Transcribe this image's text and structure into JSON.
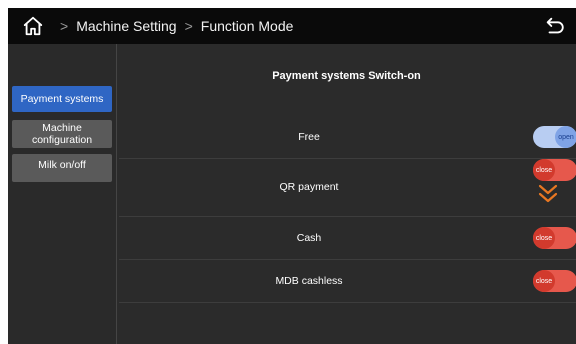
{
  "header": {
    "breadcrumbs": [
      "Machine Setting",
      "Function Mode"
    ]
  },
  "sidebar": {
    "items": [
      {
        "label": "Payment systems"
      },
      {
        "label": "Machine configuration"
      },
      {
        "label": "Milk on/off"
      }
    ]
  },
  "main": {
    "title": "Payment systems Switch-on",
    "rows": [
      {
        "label": "Free",
        "toggle": "open"
      },
      {
        "label": "QR payment",
        "toggle": "close"
      },
      {
        "label": "Cash",
        "toggle": "close"
      },
      {
        "label": "MDB cashless",
        "toggle": "close"
      }
    ]
  },
  "colors": {
    "active_tab": "#2f66c4",
    "toggle_close": "#e6584c",
    "toggle_open": "#b8cdf2",
    "chevron": "#e87722"
  },
  "icons": [
    "home-icon",
    "chevron-right-icon",
    "back-arrow-icon",
    "double-chevron-down-icon"
  ]
}
